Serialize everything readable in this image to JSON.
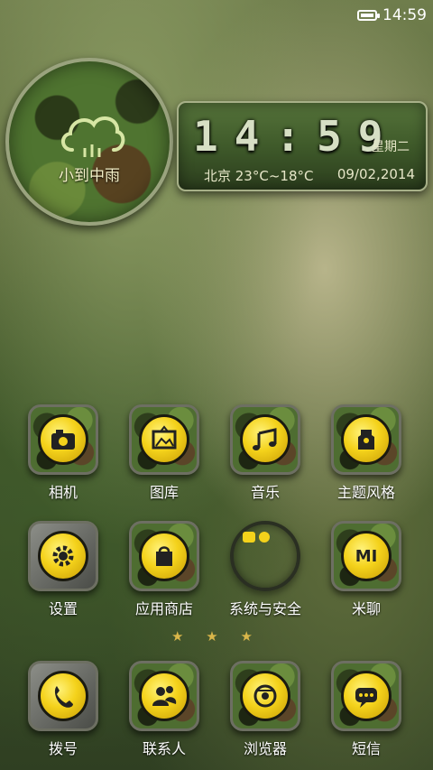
{
  "status_bar": {
    "time": "14:59"
  },
  "weather": {
    "condition": "小到中雨"
  },
  "clock": {
    "digits": "14:59",
    "weekday": "星期二",
    "location_temp": "北京 23°C~18°C",
    "date": "09/02,2014"
  },
  "apps_row1": [
    {
      "label": "相机",
      "icon": "camera-icon"
    },
    {
      "label": "图库",
      "icon": "gallery-icon"
    },
    {
      "label": "音乐",
      "icon": "music-icon"
    },
    {
      "label": "主题风格",
      "icon": "theme-icon"
    }
  ],
  "apps_row2": [
    {
      "label": "设置",
      "icon": "gear-icon"
    },
    {
      "label": "应用商店",
      "icon": "store-icon"
    },
    {
      "label": "系统与安全",
      "icon": "security-icon"
    },
    {
      "label": "米聊",
      "icon": "mi-chat-icon",
      "badge_text": "MI"
    }
  ],
  "page_indicator": {
    "text": "★ ★ ★"
  },
  "dock": [
    {
      "label": "拨号",
      "icon": "phone-icon"
    },
    {
      "label": "联系人",
      "icon": "contacts-icon"
    },
    {
      "label": "浏览器",
      "icon": "browser-icon"
    },
    {
      "label": "短信",
      "icon": "message-icon"
    }
  ]
}
